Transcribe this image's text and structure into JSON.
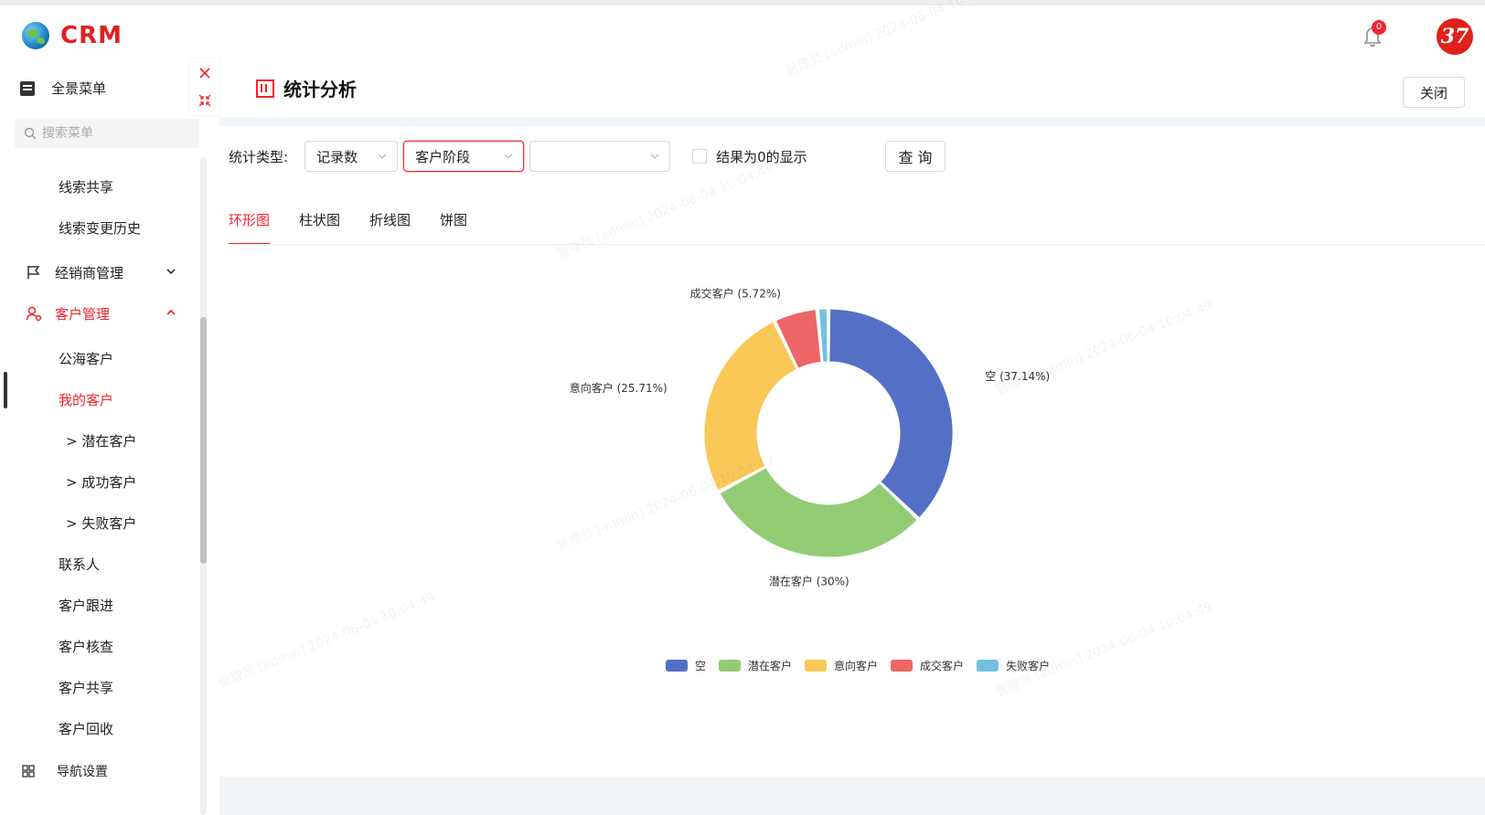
{
  "app": {
    "logo_text": "CRM",
    "notification_count": "0",
    "brand_badge": "37"
  },
  "sidebar": {
    "header": "全景菜单",
    "search_placeholder": "搜索菜单",
    "items": [
      {
        "label": "线索共享",
        "level": "sub"
      },
      {
        "label": "线索变更历史",
        "level": "sub"
      },
      {
        "label": "经销商管理",
        "level": "group",
        "expanded": false
      },
      {
        "label": "客户管理",
        "level": "group",
        "expanded": true,
        "active": true
      },
      {
        "label": "公海客户",
        "level": "sub"
      },
      {
        "label": "我的客户",
        "level": "sub",
        "active": true
      },
      {
        "label": "> 潜在客户",
        "level": "sub2"
      },
      {
        "label": "> 成功客户",
        "level": "sub2"
      },
      {
        "label": "> 失败客户",
        "level": "sub2"
      },
      {
        "label": "联系人",
        "level": "sub"
      },
      {
        "label": "客户跟进",
        "level": "sub"
      },
      {
        "label": "客户核查",
        "level": "sub"
      },
      {
        "label": "客户共享",
        "level": "sub"
      },
      {
        "label": "客户回收",
        "level": "sub"
      }
    ],
    "nav_settings": "导航设置"
  },
  "panel": {
    "title": "统计分析",
    "close_label": "关闭",
    "filter_label": "统计类型:",
    "select_1": "记录数",
    "select_2": "客户阶段",
    "select_3": "",
    "checkbox_label": "结果为0的显示",
    "query_label": "查 询",
    "tabs": [
      {
        "label": "环形图",
        "active": true
      },
      {
        "label": "柱状图",
        "active": false
      },
      {
        "label": "折线图",
        "active": false
      },
      {
        "label": "饼图",
        "active": false
      }
    ]
  },
  "watermark": "管理员 [admin] 2024-06-04 10:04:49",
  "chart_data": {
    "type": "pie",
    "variant": "donut",
    "series": [
      {
        "name": "空",
        "value": 37.14,
        "label": "空 (37.14%)",
        "color": "#5470c6"
      },
      {
        "name": "潜在客户",
        "value": 30,
        "label": "潜在客户 (30%)",
        "color": "#91cc75"
      },
      {
        "name": "意向客户",
        "value": 25.71,
        "label": "意向客户 (25.71%)",
        "color": "#fac858"
      },
      {
        "name": "成交客户",
        "value": 5.72,
        "label": "成交客户 (5.72%)",
        "color": "#ee6666"
      },
      {
        "name": "失败客户",
        "value": 1.43,
        "label": "",
        "color": "#73c0de"
      }
    ],
    "legend_position": "bottom"
  }
}
